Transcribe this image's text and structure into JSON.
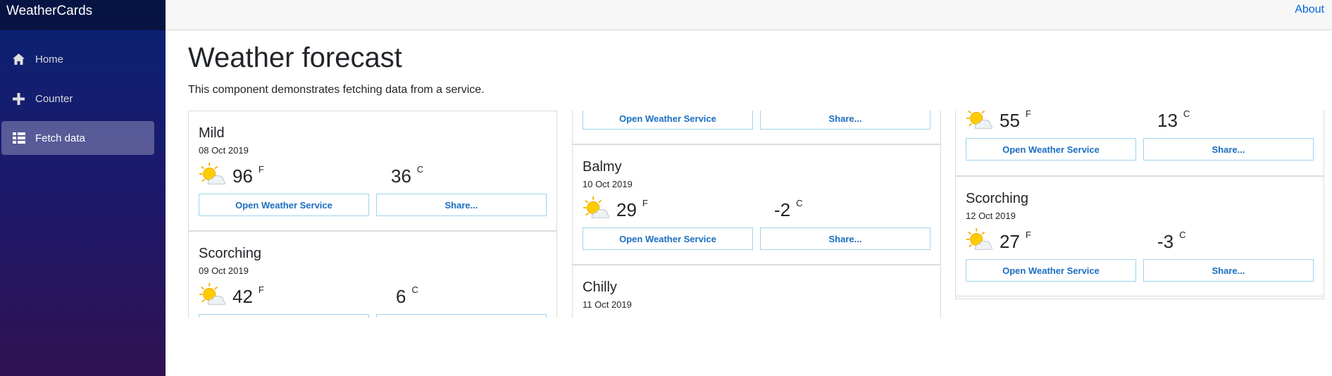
{
  "app": {
    "brand": "WeatherCards"
  },
  "sidebar": {
    "items": [
      {
        "label": "Home",
        "icon": "home-icon",
        "active": false
      },
      {
        "label": "Counter",
        "icon": "plus-icon",
        "active": false
      },
      {
        "label": "Fetch data",
        "icon": "list-icon",
        "active": true
      }
    ]
  },
  "topbar": {
    "about": "About"
  },
  "page": {
    "title": "Weather forecast",
    "description": "This component demonstrates fetching data from a service."
  },
  "buttons": {
    "open": "Open Weather Service",
    "share": "Share..."
  },
  "units": {
    "f": "F",
    "c": "C"
  },
  "columns": [
    {
      "cards": [
        {
          "summary": "Mild",
          "date": "08 Oct 2019",
          "temp_f": "96",
          "temp_c": "36"
        },
        {
          "summary": "Scorching",
          "date": "09 Oct 2019",
          "temp_f": "42",
          "temp_c": "6"
        }
      ]
    },
    {
      "cards": [
        {
          "summary": "",
          "date": "",
          "temp_f": "",
          "temp_c": ""
        },
        {
          "summary": "Balmy",
          "date": "10 Oct 2019",
          "temp_f": "29",
          "temp_c": "-2"
        },
        {
          "summary": "Chilly",
          "date": "11 Oct 2019",
          "temp_f": "",
          "temp_c": ""
        }
      ]
    },
    {
      "cards": [
        {
          "summary": "",
          "date": "",
          "temp_f": "55",
          "temp_c": "13"
        },
        {
          "summary": "Scorching",
          "date": "12 Oct 2019",
          "temp_f": "27",
          "temp_c": "-3"
        }
      ]
    }
  ]
}
